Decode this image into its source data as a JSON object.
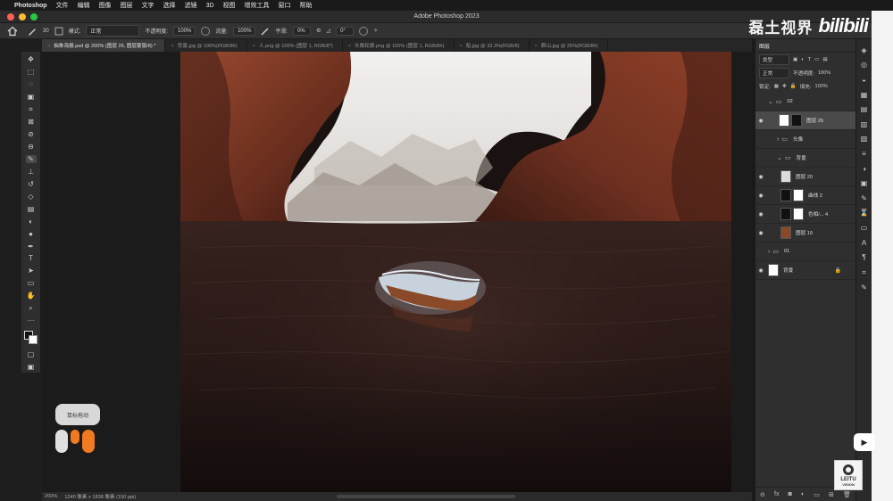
{
  "menubar": {
    "app": "Photoshop",
    "items": [
      "文件",
      "编辑",
      "图像",
      "图层",
      "文字",
      "选择",
      "滤镜",
      "3D",
      "视图",
      "增效工具",
      "窗口",
      "帮助"
    ]
  },
  "window": {
    "title": "Adobe Photoshop 2023"
  },
  "options": {
    "mode_label": "模式:",
    "mode_value": "正常",
    "opacity_label": "不透明度:",
    "opacity_value": "100%",
    "flow_label": "流量:",
    "flow_value": "100%",
    "smooth_label": "平滑:",
    "smooth_value": "0%",
    "angle_value": "0°",
    "brush_size": "30"
  },
  "watermark": {
    "text": "磊土视界",
    "logo": "bilibili"
  },
  "tabs": [
    {
      "label": "抽象海报.psd @ 200% (图层 26, 图层蒙版/8) *"
    },
    {
      "label": "背景.jpg @ 100%(RGB/8#)"
    },
    {
      "label": "人.png @ 100% (图层 1, RGB/8*)"
    },
    {
      "label": "头像轮廓.png @ 100% (图层 1, RGB/8#)"
    },
    {
      "label": "船.jpg @ 33.3%(RGB/8)"
    },
    {
      "label": "群山.jpg @ 25%(RGB/8#)"
    }
  ],
  "hint": {
    "text": "鼠标拖动"
  },
  "status": {
    "zoom": "200%",
    "info": "1240 像素 x 1838 像素 (150 ppi)"
  },
  "layers_panel": {
    "tab": "图层",
    "kind_label": "类型",
    "blend": "正常",
    "opacity_label": "不透明度:",
    "opacity": "100%",
    "lock_label": "锁定:",
    "fill_label": "填充:",
    "fill": "100%",
    "layers": [
      {
        "name": "02",
        "type": "group"
      },
      {
        "name": "图层 26",
        "type": "layer"
      },
      {
        "name": "头像",
        "type": "group"
      },
      {
        "name": "背景",
        "type": "group"
      },
      {
        "name": "图层 20",
        "type": "layer"
      },
      {
        "name": "曲线 2",
        "type": "adjust"
      },
      {
        "name": "色相/... 4",
        "type": "adjust"
      },
      {
        "name": "图层 19",
        "type": "layer"
      },
      {
        "name": "01",
        "type": "group"
      },
      {
        "name": "背景",
        "type": "background"
      }
    ]
  },
  "leitu": {
    "text": "LEITU",
    "sub": "VISION"
  }
}
